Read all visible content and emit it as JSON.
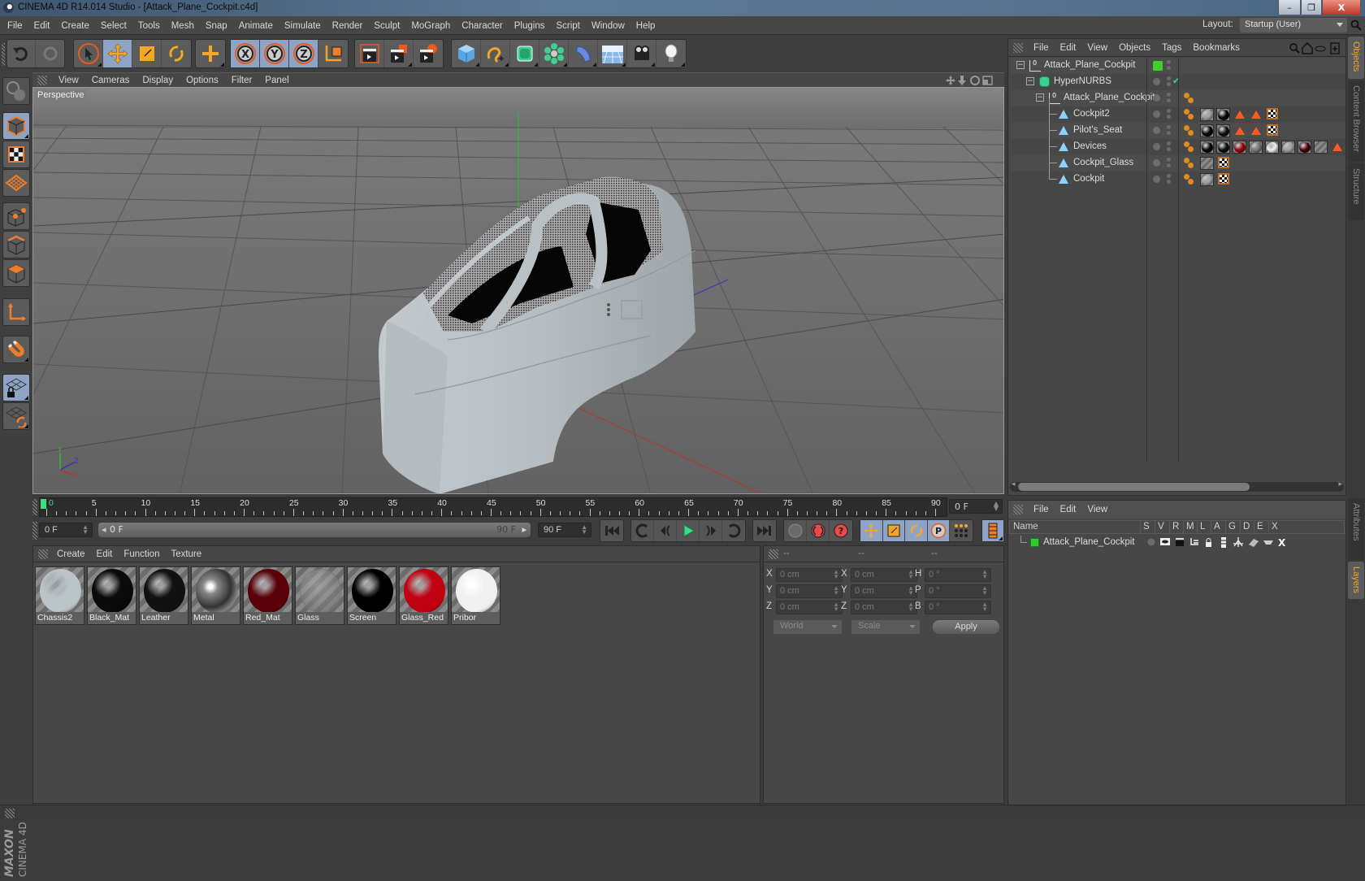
{
  "window": {
    "title": "CINEMA 4D R14.014 Studio - [Attack_Plane_Cockpit.c4d]",
    "controls": {
      "minimize": "–",
      "maximize": "❐",
      "close": "X"
    }
  },
  "menubar": {
    "items": [
      "File",
      "Edit",
      "Create",
      "Select",
      "Tools",
      "Mesh",
      "Snap",
      "Animate",
      "Simulate",
      "Render",
      "Sculpt",
      "MoGraph",
      "Character",
      "Plugins",
      "Script",
      "Window",
      "Help"
    ],
    "layout_label": "Layout:",
    "layout_value": "Startup (User)"
  },
  "toolbar": {
    "groups": [
      {
        "name": "history",
        "tools": [
          {
            "id": "undo",
            "icon": "undo-icon"
          },
          {
            "id": "redo",
            "icon": "redo-icon"
          }
        ]
      },
      {
        "name": "transform",
        "tools": [
          {
            "id": "live-selection",
            "icon": "cursor-icon"
          },
          {
            "id": "move",
            "icon": "move-icon",
            "selected": true
          },
          {
            "id": "scale",
            "icon": "scale-icon"
          },
          {
            "id": "rotate",
            "icon": "rotate-icon"
          }
        ]
      },
      {
        "name": "recent",
        "tools": [
          {
            "id": "recent-tool",
            "icon": "plus-move-icon"
          }
        ]
      },
      {
        "name": "axis",
        "tools": [
          {
            "id": "x-axis",
            "label": "X",
            "selected": true
          },
          {
            "id": "y-axis",
            "label": "Y",
            "selected": true
          },
          {
            "id": "z-axis",
            "label": "Z",
            "selected": true
          },
          {
            "id": "coordinate-system",
            "icon": "world-axis-icon"
          }
        ]
      },
      {
        "name": "render",
        "tools": [
          {
            "id": "render-view",
            "icon": "clapper-icon"
          },
          {
            "id": "render-picture-viewer",
            "icon": "clapper-red-icon"
          },
          {
            "id": "render-settings",
            "icon": "clapper-gear-icon"
          }
        ]
      },
      {
        "name": "create",
        "tools": [
          {
            "id": "cube",
            "icon": "cube-icon"
          },
          {
            "id": "spline",
            "icon": "spline-icon"
          },
          {
            "id": "nurbs",
            "icon": "nurbs-icon"
          },
          {
            "id": "array",
            "icon": "array-icon"
          },
          {
            "id": "deformer",
            "icon": "deformer-icon"
          },
          {
            "id": "floor",
            "icon": "floor-icon"
          },
          {
            "id": "camera",
            "icon": "camera-icon"
          },
          {
            "id": "light",
            "icon": "light-icon"
          }
        ]
      }
    ]
  },
  "left_toolbar": {
    "tools": [
      "make-editable",
      "model-mode",
      "texture-mode",
      "workplane-mode",
      "points-mode",
      "edges-mode",
      "polygons-mode",
      "axis-mode",
      "snap",
      "locked-workplane",
      "workplane-rotate"
    ]
  },
  "branding": {
    "line1": "MAXON",
    "line2": "CINEMA 4D"
  },
  "viewport": {
    "menu": [
      "View",
      "Cameras",
      "Display",
      "Options",
      "Filter",
      "Panel"
    ],
    "label": "Perspective",
    "axis_labels": {
      "x": "X",
      "y": "Y",
      "z": "Z"
    }
  },
  "timeline": {
    "ticks": [
      "0",
      "5",
      "10",
      "15",
      "20",
      "25",
      "30",
      "35",
      "40",
      "45",
      "50",
      "55",
      "60",
      "65",
      "70",
      "75",
      "80",
      "85",
      "90"
    ],
    "current_frame": "0 F",
    "start_field": "0 F",
    "range_start": "0 F",
    "range_end": "90 F",
    "end_field": "90 F",
    "playhead_color": "#3ddc84"
  },
  "playback": {
    "buttons": [
      "go-to-start",
      "go-to-previous-key",
      "step-back",
      "play",
      "step-forward",
      "go-to-next-key",
      "go-to-end"
    ],
    "key_buttons": [
      "record-disabled",
      "autokey",
      "keyframe-selection"
    ],
    "track_buttons": [
      "position-track",
      "scale-track",
      "rotation-track",
      "param-track",
      "point-level-animation"
    ],
    "timeline_button": "timeline-film"
  },
  "materials": {
    "menu": [
      "Create",
      "Edit",
      "Function",
      "Texture"
    ],
    "items": [
      {
        "name": "Chassis2",
        "color": "#b9c3c8"
      },
      {
        "name": "Black_Mat",
        "color": "#0a0a0a"
      },
      {
        "name": "Leather",
        "color": "#111111"
      },
      {
        "name": "Metal",
        "color": "#8a8a8a"
      },
      {
        "name": "Red_Mat",
        "color": "#5a0008"
      },
      {
        "name": "Glass",
        "color": "#8a8a8a"
      },
      {
        "name": "Screen",
        "color": "#000000"
      },
      {
        "name": "Glass_Red",
        "color": "#c00010"
      },
      {
        "name": "Pribor",
        "color": "#f0f0f0"
      }
    ]
  },
  "coordinates": {
    "headers": [
      "--",
      "--",
      "--"
    ],
    "rows": [
      {
        "pos_label": "X",
        "pos": "0 cm",
        "size_label": "X",
        "size": "0 cm",
        "rot_label": "H",
        "rot": "0 °"
      },
      {
        "pos_label": "Y",
        "pos": "0 cm",
        "size_label": "Y",
        "size": "0 cm",
        "rot_label": "P",
        "rot": "0 °"
      },
      {
        "pos_label": "Z",
        "pos": "0 cm",
        "size_label": "Z",
        "size": "0 cm",
        "rot_label": "B",
        "rot": "0 °"
      }
    ],
    "mode": "World",
    "size_mode": "Scale",
    "apply_label": "Apply"
  },
  "object_manager": {
    "menu": [
      "File",
      "Edit",
      "View",
      "Objects",
      "Tags",
      "Bookmarks"
    ],
    "objects": [
      {
        "name": "Attack_Plane_Cockpit",
        "type": "null",
        "depth": 0,
        "tags": []
      },
      {
        "name": "HyperNURBS",
        "type": "hypernurbs",
        "depth": 1,
        "enabled": "✔",
        "tags": []
      },
      {
        "name": "Attack_Plane_Cockpit",
        "type": "null",
        "depth": 2,
        "tags": [
          "phong"
        ]
      },
      {
        "name": "Cockpit2",
        "type": "polygon",
        "depth": 3,
        "tags": [
          "phong",
          "mat:#9aa4aa",
          "mat:#050505",
          "selection",
          "selection",
          "uvw"
        ]
      },
      {
        "name": "Pilot's_Seat",
        "type": "polygon",
        "depth": 3,
        "tags": [
          "phong",
          "mat:#050505",
          "mat:#101010",
          "selection",
          "selection",
          "uvw"
        ]
      },
      {
        "name": "Devices",
        "type": "polygon",
        "depth": 3,
        "tags": [
          "phong",
          "mat:#050505",
          "mat:#101010",
          "mat:#9a0008",
          "mat:#777777",
          "mat:#f0f0f0",
          "mat:#9aa4aa",
          "mat:#4a0006",
          "glass",
          "selection"
        ]
      },
      {
        "name": "Cockpit_Glass",
        "type": "polygon",
        "depth": 3,
        "tags": [
          "phong",
          "glass",
          "uvw"
        ]
      },
      {
        "name": "Cockpit",
        "type": "polygon",
        "depth": 3,
        "tags": [
          "phong",
          "mat:#9aa4aa",
          "uvw"
        ]
      }
    ]
  },
  "layer_manager": {
    "menu": [
      "File",
      "Edit",
      "View"
    ],
    "columns": [
      "Name",
      "S",
      "V",
      "R",
      "M",
      "L",
      "A",
      "G",
      "D",
      "E",
      "X"
    ],
    "layers": [
      {
        "name": "Attack_Plane_Cockpit",
        "color": "#2ecc2e"
      }
    ]
  },
  "right_tabs": {
    "top": [
      {
        "label": "Objects",
        "active": true
      },
      {
        "label": "Content Browser",
        "active": false
      },
      {
        "label": "Structure",
        "active": false
      }
    ],
    "bottom": [
      {
        "label": "Attributes",
        "active": false
      },
      {
        "label": "Layers",
        "active": true
      }
    ]
  }
}
